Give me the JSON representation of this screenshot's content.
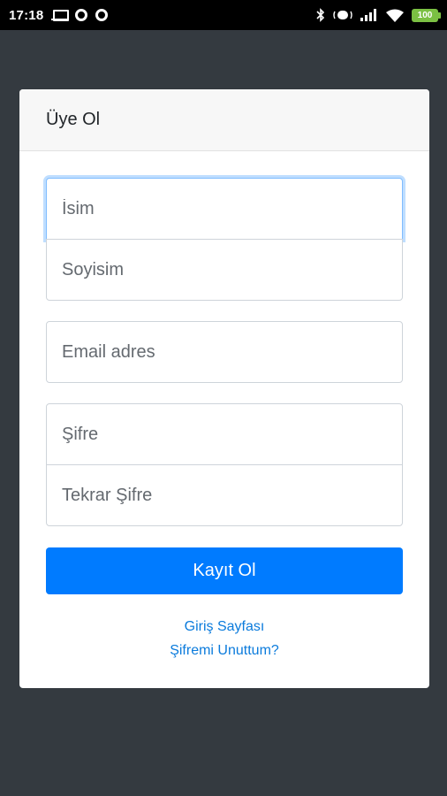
{
  "status_bar": {
    "time": "17:18",
    "left_icons": [
      "laptop-icon",
      "circle-icon",
      "circle-icon"
    ],
    "right_icons": [
      "bluetooth-icon",
      "vibrate-icon",
      "signal-icon",
      "wifi-icon",
      "battery-icon"
    ],
    "battery_level": "100"
  },
  "card": {
    "title": "Üye Ol"
  },
  "form": {
    "first_name_placeholder": "İsim",
    "last_name_placeholder": "Soyisim",
    "email_placeholder": "Email adres",
    "password_placeholder": "Şifre",
    "password_repeat_placeholder": "Tekrar Şifre",
    "submit_label": "Kayıt Ol"
  },
  "links": {
    "login_page": "Giriş Sayfası",
    "forgot_password": "Şifremi Unuttum?"
  },
  "colors": {
    "background": "#343a40",
    "primary": "#007bff",
    "link": "#0b7bdc",
    "battery": "#7bc043"
  }
}
